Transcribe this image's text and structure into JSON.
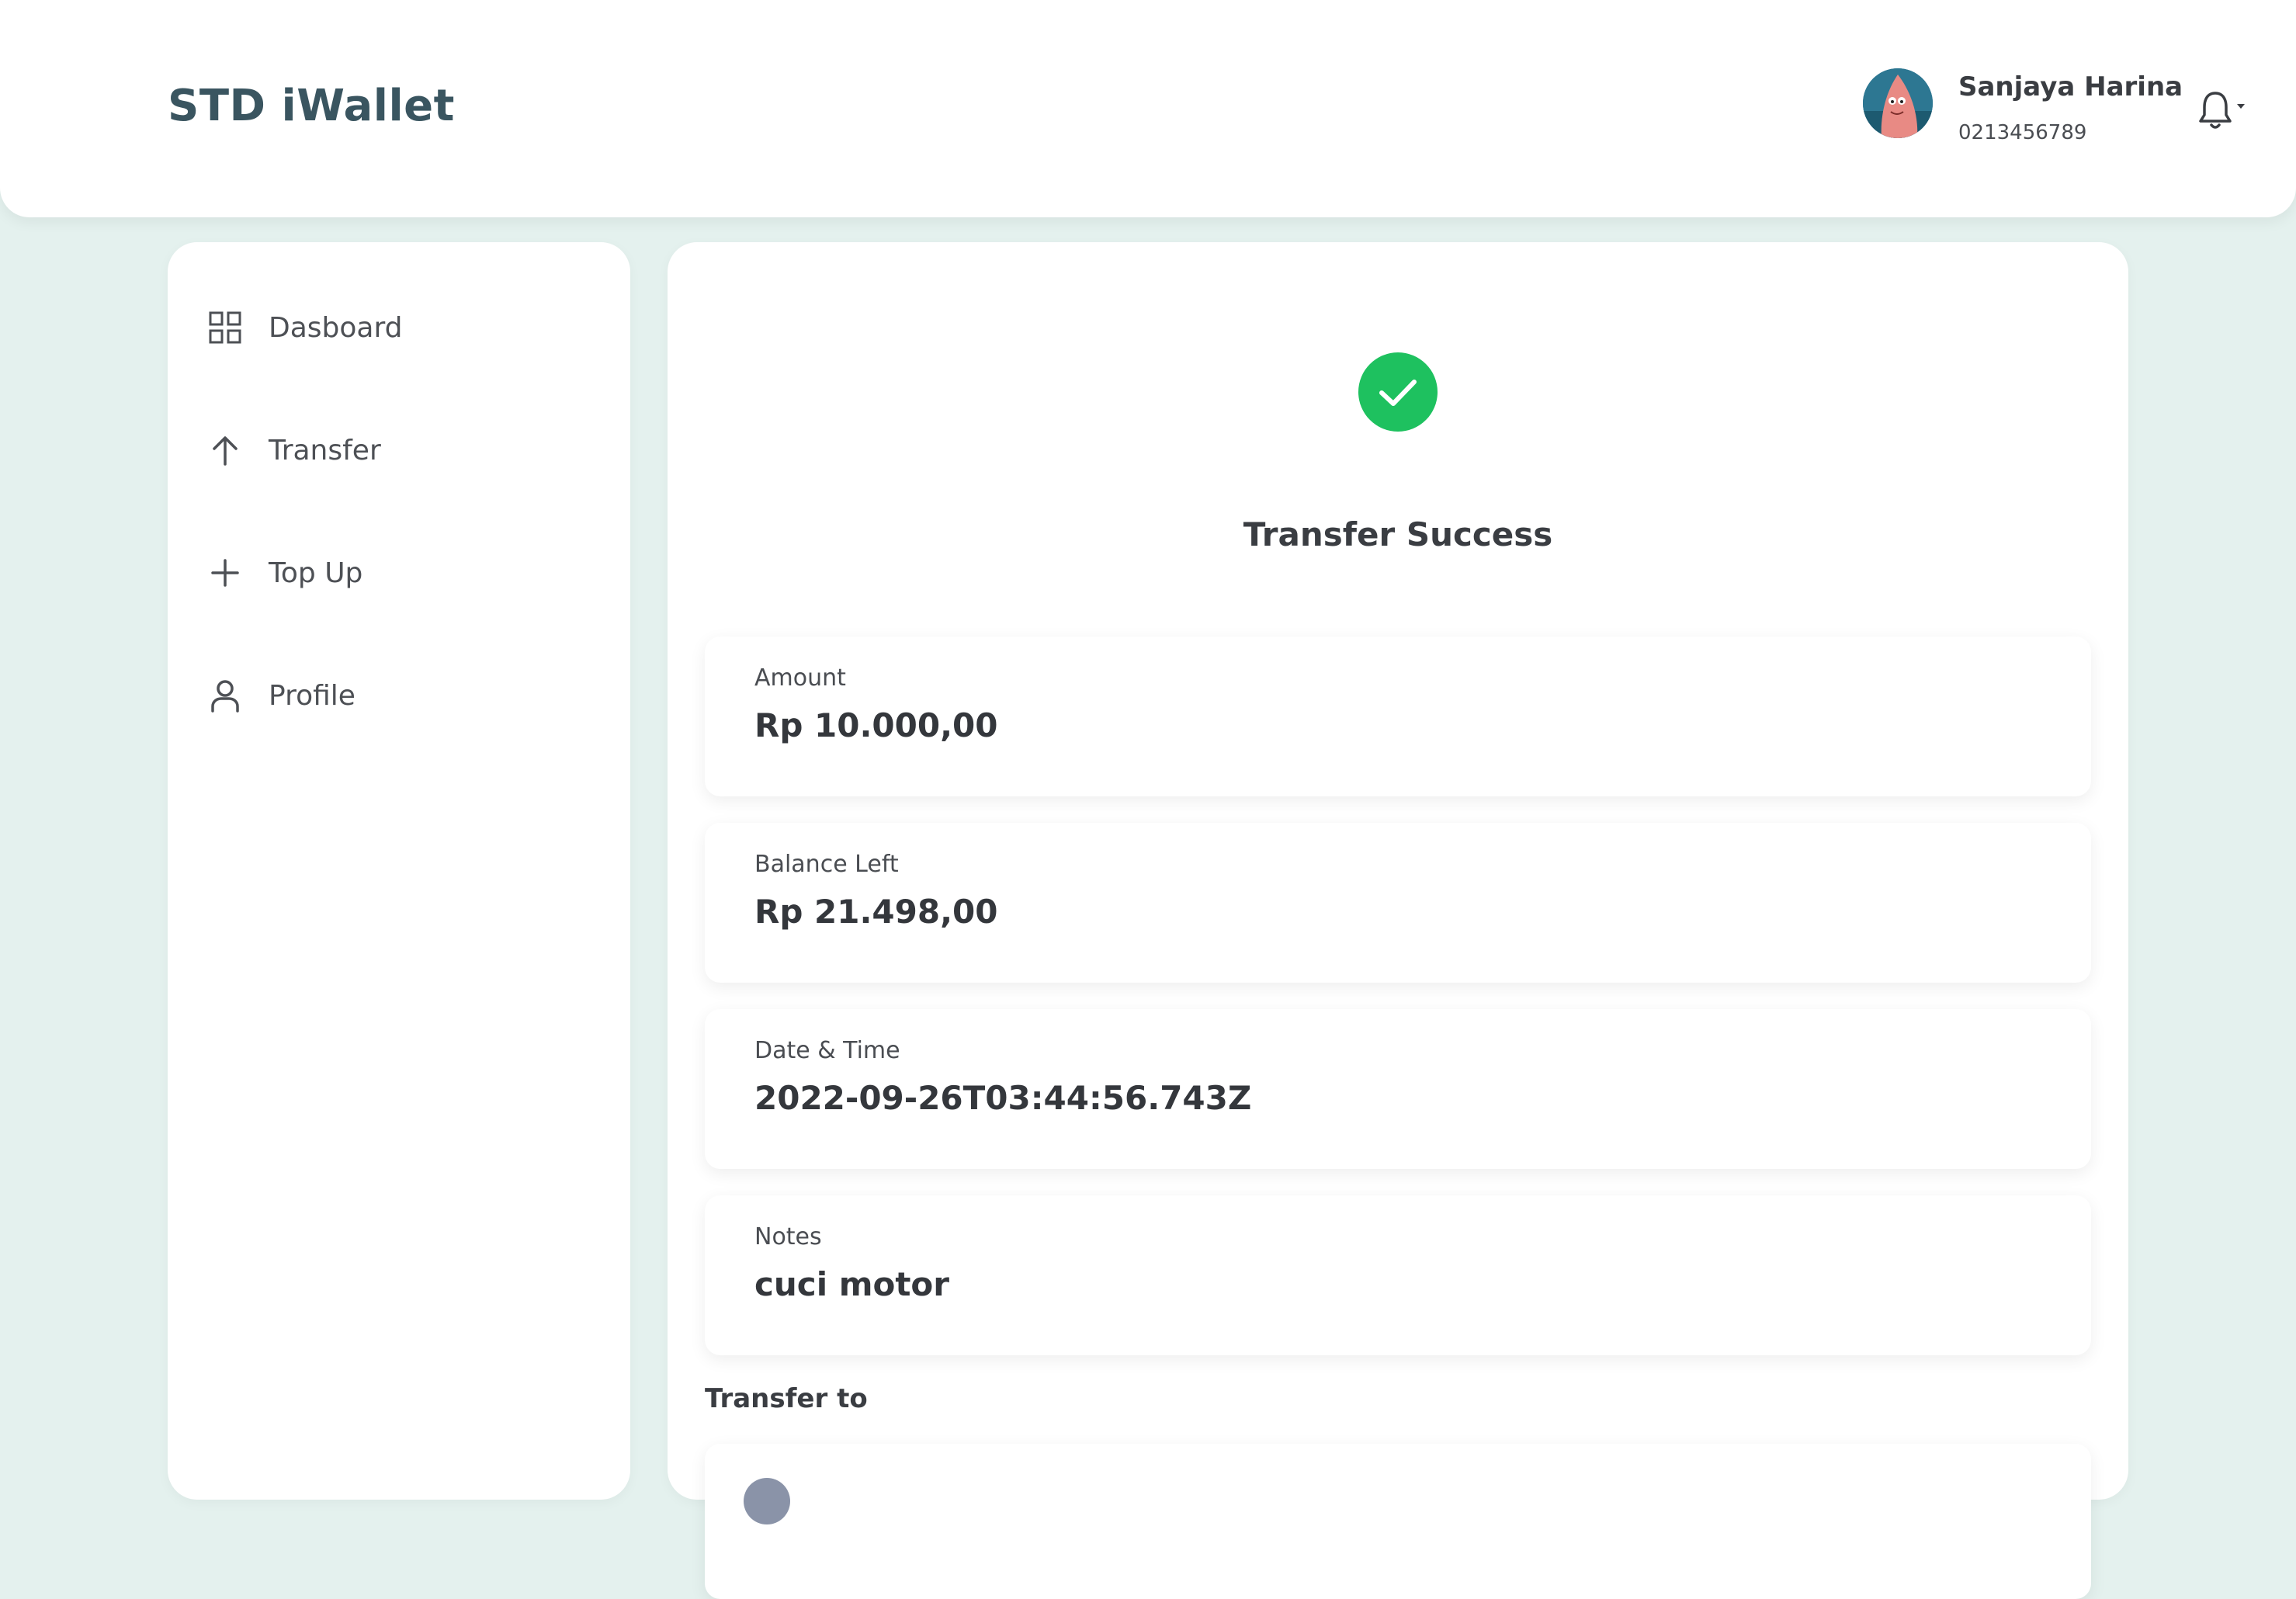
{
  "header": {
    "brand": "STD iWallet",
    "user": {
      "name": "Sanjaya Harina",
      "phone": "0213456789",
      "avatar_icon": "user-avatar-photo"
    },
    "notification_icon": "bell-icon"
  },
  "sidebar": {
    "items": [
      {
        "label": "Dasboard",
        "icon": "grid-icon"
      },
      {
        "label": "Transfer",
        "icon": "arrow-up-icon"
      },
      {
        "label": "Top Up",
        "icon": "plus-icon"
      },
      {
        "label": "Profile",
        "icon": "user-icon"
      }
    ]
  },
  "main": {
    "status_icon": "check-circle-icon",
    "title": "Transfer Success",
    "details": [
      {
        "label": "Amount",
        "value": "Rp 10.000,00"
      },
      {
        "label": "Balance Left",
        "value": "Rp 21.498,00"
      },
      {
        "label": "Date & Time",
        "value": "2022-09-26T03:44:56.743Z"
      },
      {
        "label": "Notes",
        "value": "cuci motor"
      }
    ],
    "transfer_to_label": "Transfer to"
  },
  "colors": {
    "background": "#e4f1ee",
    "brand": "#3a5560",
    "success": "#1ec15f"
  }
}
